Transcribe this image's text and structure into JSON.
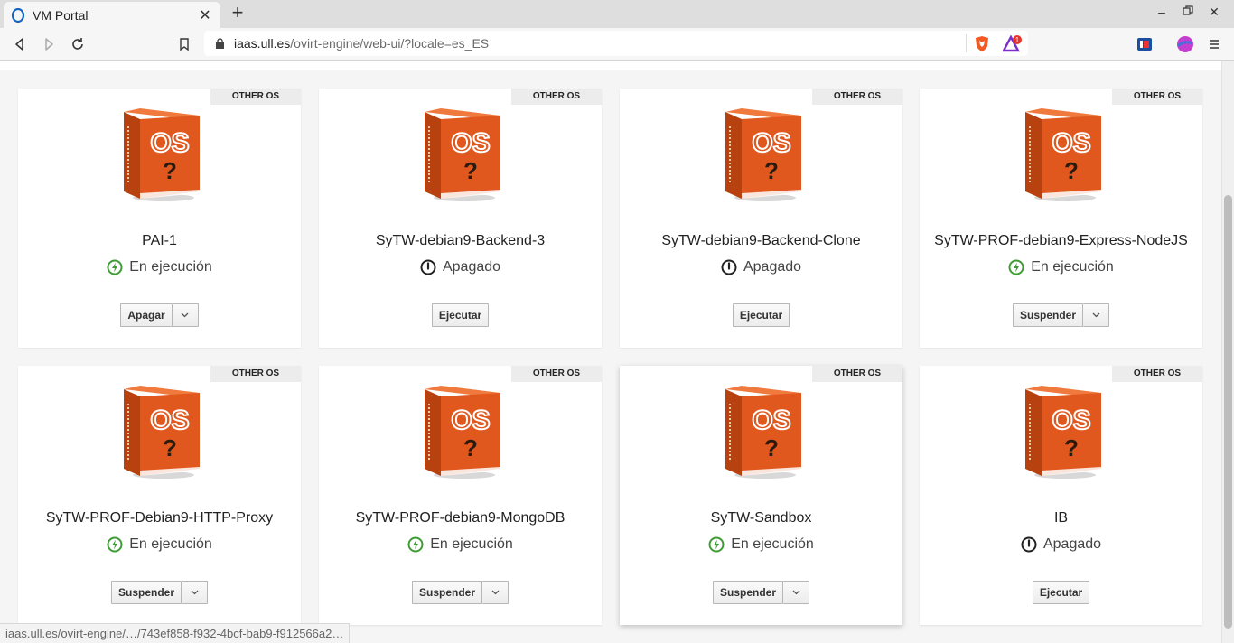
{
  "browser": {
    "tab_title": "VM Portal",
    "url_host": "iaas.ull.es",
    "url_path": "/ovirt-engine/web-ui/?locale=es_ES",
    "shield_badge": "1",
    "status_url": "iaas.ull.es/ovirt-engine/…/743ef858-f932-4bcf-bab9-f912566a2…"
  },
  "colors": {
    "running_green": "#3f9c35",
    "os_orange": "#e0581e"
  },
  "vms": [
    {
      "name": "PAI-1",
      "os_badge": "OTHER OS",
      "status": "En ejecución",
      "state": "running",
      "action": "Apagar",
      "has_dropdown": true
    },
    {
      "name": "SyTW-debian9-Backend-3",
      "os_badge": "OTHER OS",
      "status": "Apagado",
      "state": "off",
      "action": "Ejecutar",
      "has_dropdown": false
    },
    {
      "name": "SyTW-debian9-Backend-Clone",
      "os_badge": "OTHER OS",
      "status": "Apagado",
      "state": "off",
      "action": "Ejecutar",
      "has_dropdown": false
    },
    {
      "name": "SyTW-PROF-debian9-Express-NodeJS",
      "os_badge": "OTHER OS",
      "status": "En ejecución",
      "state": "running",
      "action": "Suspender",
      "has_dropdown": true
    },
    {
      "name": "SyTW-PROF-Debian9-HTTP-Proxy",
      "os_badge": "OTHER OS",
      "status": "En ejecución",
      "state": "running",
      "action": "Suspender",
      "has_dropdown": true
    },
    {
      "name": "SyTW-PROF-debian9-MongoDB",
      "os_badge": "OTHER OS",
      "status": "En ejecución",
      "state": "running",
      "action": "Suspender",
      "has_dropdown": true
    },
    {
      "name": "SyTW-Sandbox",
      "os_badge": "OTHER OS",
      "status": "En ejecución",
      "state": "running",
      "action": "Suspender",
      "has_dropdown": true
    },
    {
      "name": "IB",
      "os_badge": "OTHER OS",
      "status": "Apagado",
      "state": "off",
      "action": "Ejecutar",
      "has_dropdown": false
    }
  ]
}
